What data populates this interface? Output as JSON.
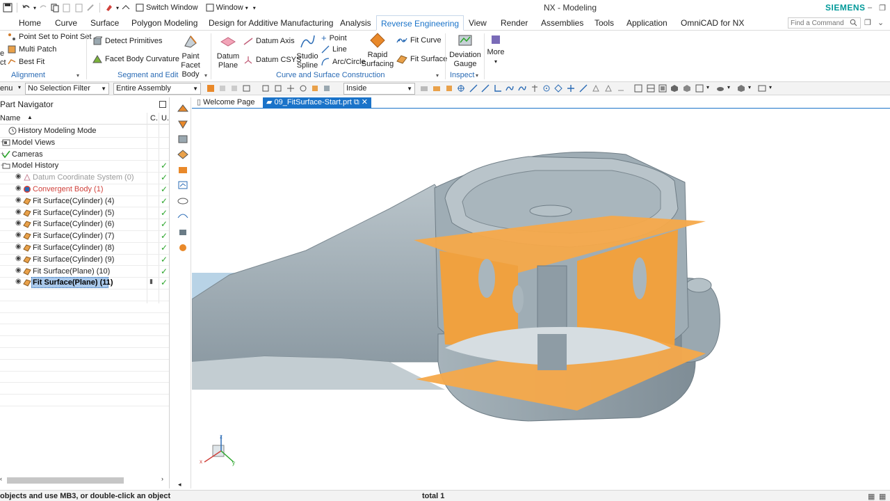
{
  "app": {
    "title": "NX - Modeling",
    "brand": "SIEMENS",
    "switch_window": "Switch Window",
    "window_menu": "Window"
  },
  "menu": {
    "tabs": [
      "Home",
      "Curve",
      "Surface",
      "Polygon Modeling",
      "Design for Additive Manufacturing",
      "Analysis",
      "Reverse Engineering",
      "View",
      "Render",
      "Assemblies",
      "Tools",
      "Application",
      "OmniCAD for NX"
    ],
    "active_tab": "Reverse Engineering",
    "search_placeholder": "Find a Command"
  },
  "ribbon": {
    "alignment": {
      "items": [
        "Point Set to Point Set",
        "Multi Patch",
        "Best Fit"
      ],
      "left_fragments": [
        "e",
        "ct"
      ],
      "label": "Alignment"
    },
    "segment": {
      "detect": "Detect Primitives",
      "facet_curv": "Facet Body Curvature",
      "paint1": "Paint",
      "paint2": "Facet Body",
      "label": "Segment and Edit"
    },
    "curve_surface": {
      "datum_plane1": "Datum",
      "datum_plane2": "Plane",
      "datum_axis": "Datum Axis",
      "datum_csys": "Datum CSYS",
      "studio1": "Studio",
      "studio2": "Spline",
      "point": "Point",
      "line": "Line",
      "arc": "Arc/Circle",
      "rapid1": "Rapid",
      "rapid2": "Surfacing",
      "fit_curve": "Fit Curve",
      "fit_surface": "Fit Surface",
      "label": "Curve and Surface Construction"
    },
    "inspect": {
      "deviation1": "Deviation",
      "deviation2": "Gauge",
      "label": "Inspect"
    },
    "more": "More"
  },
  "selection_bar": {
    "menu_fragment": "enu",
    "filter": "No Selection Filter",
    "scope": "Entire Assembly",
    "inside": "Inside"
  },
  "navigator": {
    "title": "Part Navigator",
    "col_name": "Name",
    "col_c": "C.",
    "col_u": "U.",
    "rows": [
      {
        "label": "History Modeling Mode",
        "color": "#222222"
      },
      {
        "label": "Model Views",
        "color": "#222222"
      },
      {
        "label": "Cameras",
        "color": "#222222"
      },
      {
        "label": "Model History",
        "color": "#222222"
      },
      {
        "label": "Datum Coordinate System (0)",
        "color": "#9a9a9a"
      },
      {
        "label": "Convergent Body (1)",
        "color": "#d0413b"
      },
      {
        "label": "Fit Surface(Cylinder) (4)",
        "color": "#222222"
      },
      {
        "label": "Fit Surface(Cylinder) (5)",
        "color": "#222222"
      },
      {
        "label": "Fit Surface(Cylinder) (6)",
        "color": "#222222"
      },
      {
        "label": "Fit Surface(Cylinder) (7)",
        "color": "#222222"
      },
      {
        "label": "Fit Surface(Cylinder) (8)",
        "color": "#222222"
      },
      {
        "label": "Fit Surface(Cylinder) (9)",
        "color": "#222222"
      },
      {
        "label": "Fit Surface(Plane) (10)",
        "color": "#222222"
      },
      {
        "label": "Fit Surface(Plane) (11)",
        "color": "#000000"
      }
    ]
  },
  "documents": {
    "tabs": [
      "Welcome Page",
      "09_FitSurface-Start.prt"
    ],
    "active": "09_FitSurface-Start.prt"
  },
  "status": {
    "prompt": "objects and use MB3, or double-click an object",
    "total": "total 1"
  },
  "colors": {
    "accent": "#1a73c9",
    "surface": "#f5a94a",
    "part": "#9aa8b0",
    "check": "#2aa52a"
  }
}
